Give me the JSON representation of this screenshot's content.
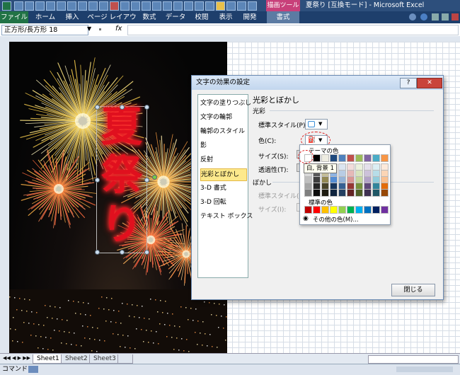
{
  "window": {
    "title": "夏祭り [互換モード] - Microsoft Excel",
    "contextual_tab": "描画ツール"
  },
  "ribbon": {
    "tabs": [
      "ファイル",
      "ホーム",
      "挿入",
      "ページ レイアウト",
      "数式",
      "データ",
      "校閲",
      "表示",
      "開発",
      "書式"
    ]
  },
  "formula_bar": {
    "name_box": "正方形/長方形 18",
    "fx": "fx"
  },
  "sheet": {
    "title_text_chars": [
      "夏",
      "祭",
      "り"
    ],
    "tabs": [
      "Sheet1",
      "Sheet2",
      "Sheet3"
    ],
    "status": "コマンド"
  },
  "dialog": {
    "title": "文字の効果の設定",
    "help": "?",
    "close_x": "✕",
    "categories": [
      "文字の塗りつぶし",
      "文字の輪郭",
      "輪郭のスタイル",
      "影",
      "反射",
      "光彩とぼかし",
      "3-D 書式",
      "3-D 回転",
      "テキスト ボックス"
    ],
    "selected_category": "光彩とぼかし",
    "panel_title": "光彩とぼかし",
    "glow_section": "光彩",
    "preset_label": "標準スタイル(P):",
    "color_label": "色(C):",
    "size_label": "サイズ(S):",
    "transparency_label": "透過性(T):",
    "soft_section": "ぼかし",
    "soft_preset_label": "標準スタイル(R):",
    "soft_size_label": "サイズ(I):",
    "close_button": "閉じる"
  },
  "color_picker": {
    "theme_label": "テーマの色",
    "standard_label": "標準の色",
    "more_colors": "その他の色(M)...",
    "tooltip": "白, 背景 1",
    "theme_top_row": [
      "#ffffff",
      "#000000",
      "#eeece1",
      "#1f497d",
      "#4f81bd",
      "#c0504d",
      "#9bbb59",
      "#8064a2",
      "#4bacc6",
      "#f79646"
    ],
    "theme_columns": [
      [
        "#f2f2f2",
        "#d8d8d8",
        "#bfbfbf",
        "#a5a5a5",
        "#7f7f7f"
      ],
      [
        "#7f7f7f",
        "#595959",
        "#3f3f3f",
        "#262626",
        "#0c0c0c"
      ],
      [
        "#ddd9c3",
        "#c4bd97",
        "#938953",
        "#494429",
        "#1d1b10"
      ],
      [
        "#c6d9f0",
        "#8db3e2",
        "#548dd4",
        "#17365d",
        "#0f243e"
      ],
      [
        "#dbe5f1",
        "#b8cce4",
        "#95b3d7",
        "#366092",
        "#244061"
      ],
      [
        "#f2dcdb",
        "#e5b9b7",
        "#d99694",
        "#953734",
        "#632423"
      ],
      [
        "#ebf1dd",
        "#d7e3bc",
        "#c3d69b",
        "#76923c",
        "#4f6128"
      ],
      [
        "#e5e0ec",
        "#ccc1d9",
        "#b2a2c7",
        "#5f497a",
        "#3f3151"
      ],
      [
        "#dbeef3",
        "#b7dde8",
        "#92cddc",
        "#31859b",
        "#205867"
      ],
      [
        "#fdeada",
        "#fbd5b5",
        "#fac08f",
        "#e36c09",
        "#974806"
      ]
    ],
    "standard_colors": [
      "#c00000",
      "#ff0000",
      "#ffc000",
      "#ffff00",
      "#92d050",
      "#00b050",
      "#00b0f0",
      "#0070c0",
      "#002060",
      "#7030a0"
    ]
  }
}
